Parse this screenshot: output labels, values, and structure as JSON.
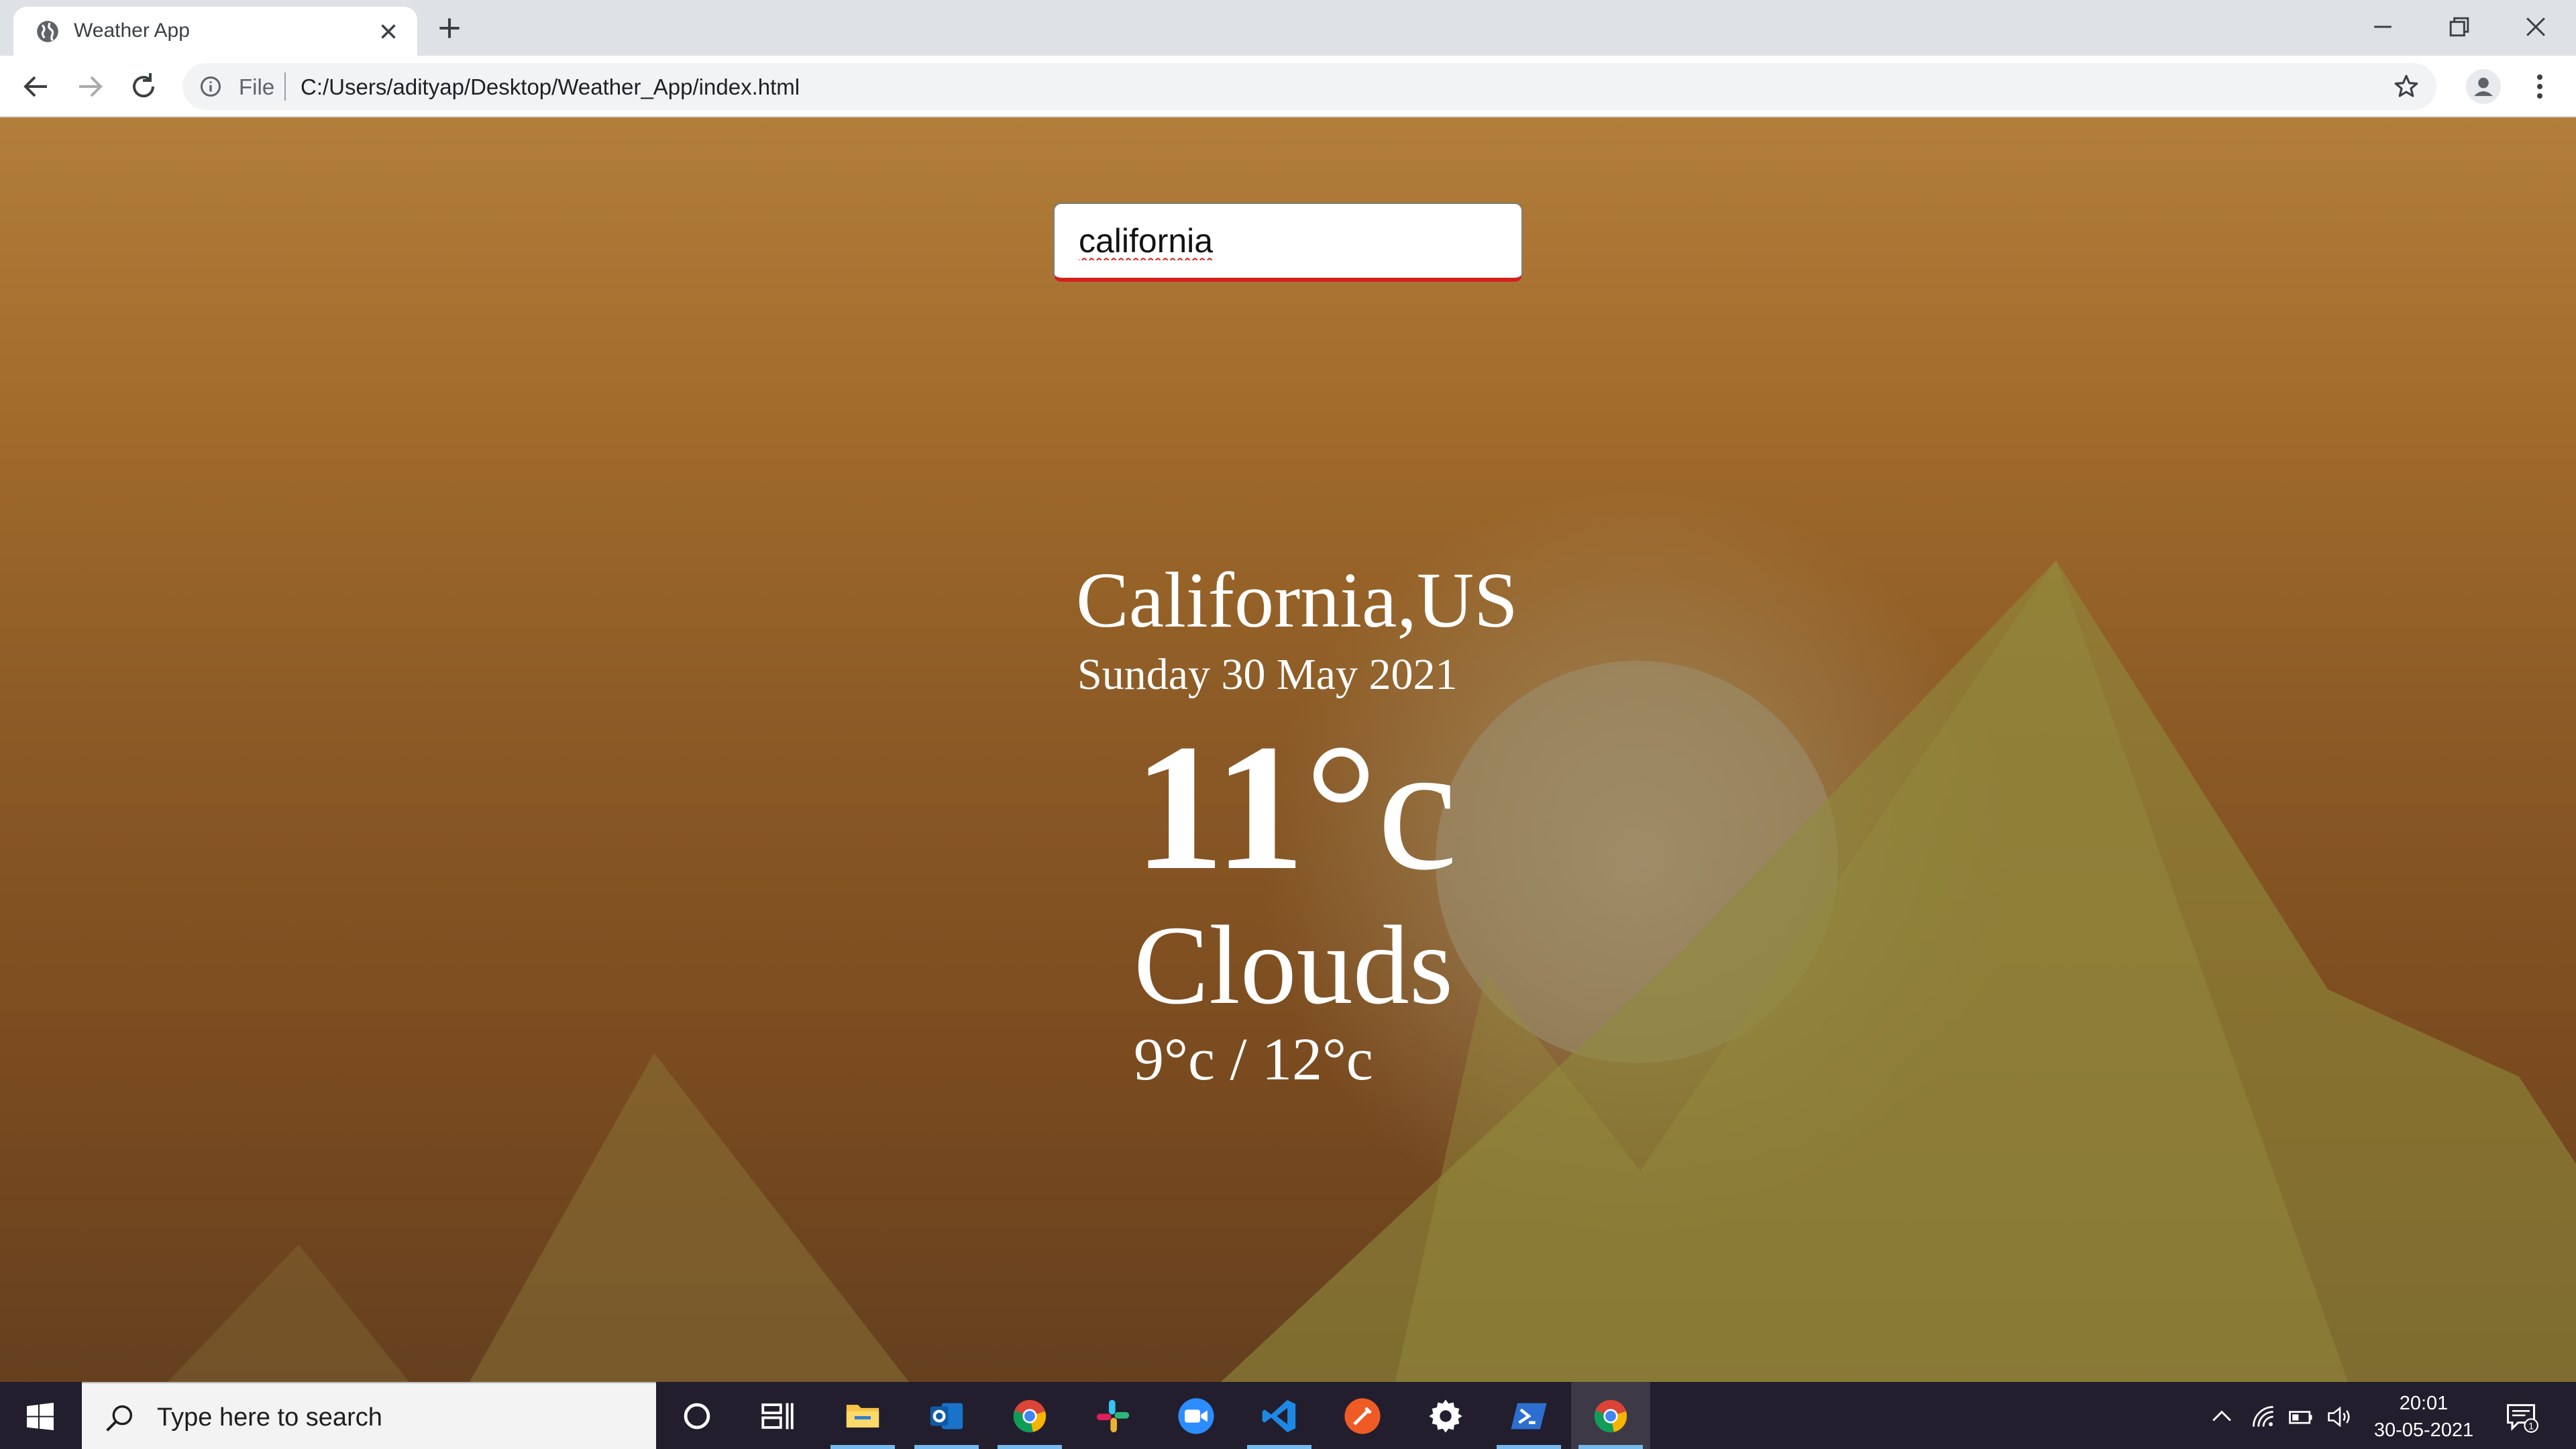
{
  "browser": {
    "tab_title": "Weather App",
    "omnibox_scheme_label": "File",
    "url": "C:/Users/adityap/Desktop/Weather_App/index.html"
  },
  "app": {
    "search_value": "california",
    "location": "California,US",
    "date": "Sunday 30 May 2021",
    "temperature": "11",
    "temperature_unit": "°c",
    "condition": "Clouds",
    "min_max": "9°c / 12°c"
  },
  "taskbar": {
    "search_placeholder": "Type here to search",
    "time": "20:01",
    "date": "30-05-2021",
    "notification_count": "1",
    "pinned_apps": [
      "task-view",
      "file-explorer",
      "outlook",
      "chrome",
      "slack",
      "zoom",
      "vscode",
      "postman",
      "settings",
      "powershell",
      "chrome"
    ]
  },
  "colors": {
    "background_top": "#b27e3a",
    "background_bottom": "#65401f",
    "search_underline": "#d42020",
    "text": "#ffffff",
    "taskbar": "#221e2d"
  }
}
